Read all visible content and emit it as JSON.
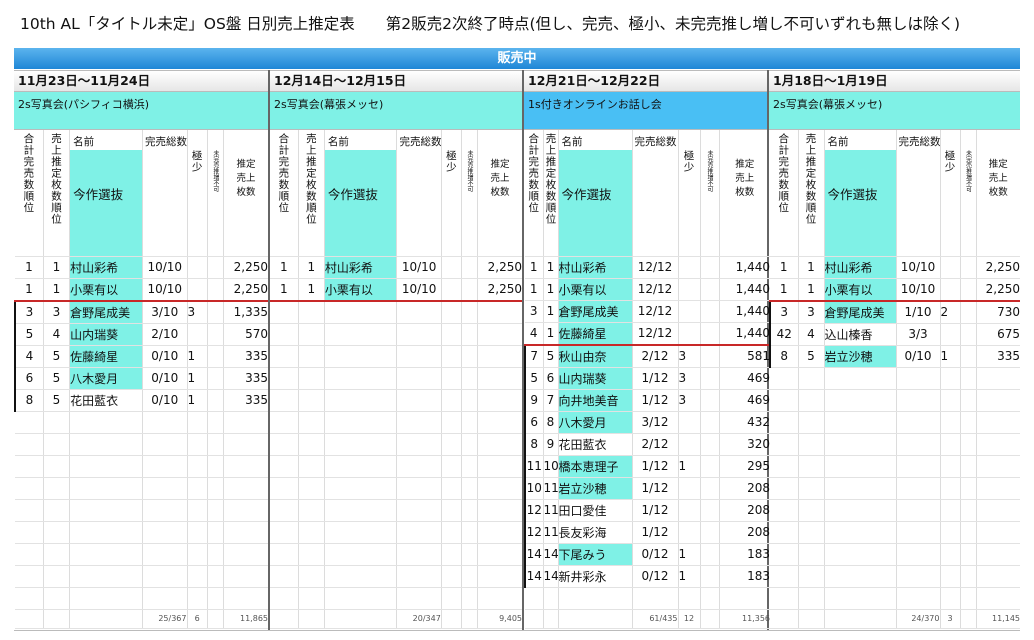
{
  "title": "10th AL「タイトル未定」OS盤 日別売上推定表　　第2販売2次終了時点(但し、完売、極小、未完売推し増し不可いずれも無しは除く)",
  "banner": "販売中",
  "headers": {
    "rank_total": "合計完売数順位",
    "rank_sales": "売上推定枚数順位",
    "name": "名前",
    "current_select": "今作選抜",
    "sold_out_total": "完売総数",
    "kyokusho": "極少",
    "unsold_no_add": "未完売推増不可",
    "estimate_line1": "推定",
    "estimate_line2": "売上",
    "estimate_line3": "枚数"
  },
  "colors": {
    "cyan": "#7ff1e6",
    "blue_event": "#49bff4",
    "banner": "#2a8fdc",
    "cutoff_line": "#c82828"
  },
  "panels": [
    {
      "date": "11月23日〜11月24日",
      "event": "2s写真会(パシフィコ横浜)",
      "rows": [
        {
          "r1": "1",
          "r2": "1",
          "name": "村山彩希",
          "sold": "10/10",
          "ky": "",
          "est": "2,250",
          "cyan": true
        },
        {
          "r1": "1",
          "r2": "1",
          "name": "小栗有以",
          "sold": "10/10",
          "ky": "",
          "est": "2,250",
          "cyan": true,
          "cut": true
        },
        {
          "r1": "3",
          "r2": "3",
          "name": "倉野尾成美",
          "sold": "3/10",
          "ky": "3",
          "est": "1,335",
          "cyan": true
        },
        {
          "r1": "5",
          "r2": "4",
          "name": "山内瑞葵",
          "sold": "2/10",
          "ky": "",
          "est": "570",
          "cyan": true
        },
        {
          "r1": "4",
          "r2": "5",
          "name": "佐藤綺星",
          "sold": "0/10",
          "ky": "1",
          "est": "335",
          "cyan": true
        },
        {
          "r1": "6",
          "r2": "5",
          "name": "八木愛月",
          "sold": "0/10",
          "ky": "1",
          "est": "335",
          "cyan": true
        },
        {
          "r1": "8",
          "r2": "5",
          "name": "花田藍衣",
          "sold": "0/10",
          "ky": "1",
          "est": "335",
          "cyan": false
        }
      ],
      "total": {
        "sold": "25/367",
        "ky": "6",
        "est": "11,865"
      }
    },
    {
      "date": "12月14日〜12月15日",
      "event": "2s写真会(幕張メッセ)",
      "rows": [
        {
          "r1": "1",
          "r2": "1",
          "name": "村山彩希",
          "sold": "10/10",
          "ky": "",
          "est": "2,250",
          "cyan": true
        },
        {
          "r1": "1",
          "r2": "1",
          "name": "小栗有以",
          "sold": "10/10",
          "ky": "",
          "est": "2,250",
          "cyan": true,
          "cut": true
        }
      ],
      "total": {
        "sold": "20/347",
        "ky": "",
        "est": "9,405"
      }
    },
    {
      "date": "12月21日〜12月22日",
      "event": "1s付きオンラインお話し会",
      "rows": [
        {
          "r1": "1",
          "r2": "1",
          "name": "村山彩希",
          "sold": "12/12",
          "ky": "",
          "est": "1,440",
          "cyan": true
        },
        {
          "r1": "1",
          "r2": "1",
          "name": "小栗有以",
          "sold": "12/12",
          "ky": "",
          "est": "1,440",
          "cyan": true
        },
        {
          "r1": "3",
          "r2": "1",
          "name": "倉野尾成美",
          "sold": "12/12",
          "ky": "",
          "est": "1,440",
          "cyan": true
        },
        {
          "r1": "4",
          "r2": "1",
          "name": "佐藤綺星",
          "sold": "12/12",
          "ky": "",
          "est": "1,440",
          "cyan": true,
          "cut": true
        },
        {
          "r1": "7",
          "r2": "5",
          "name": "秋山由奈",
          "sold": "2/12",
          "ky": "3",
          "est": "581",
          "cyan": true
        },
        {
          "r1": "5",
          "r2": "6",
          "name": "山内瑞葵",
          "sold": "1/12",
          "ky": "3",
          "est": "469",
          "cyan": true
        },
        {
          "r1": "9",
          "r2": "7",
          "name": "向井地美音",
          "sold": "1/12",
          "ky": "3",
          "est": "469",
          "cyan": true
        },
        {
          "r1": "6",
          "r2": "8",
          "name": "八木愛月",
          "sold": "3/12",
          "ky": "",
          "est": "432",
          "cyan": true
        },
        {
          "r1": "8",
          "r2": "9",
          "name": "花田藍衣",
          "sold": "2/12",
          "ky": "",
          "est": "320",
          "cyan": false
        },
        {
          "r1": "11",
          "r2": "10",
          "name": "橋本恵理子",
          "sold": "1/12",
          "ky": "1",
          "est": "295",
          "cyan": true
        },
        {
          "r1": "10",
          "r2": "11",
          "name": "岩立沙穂",
          "sold": "1/12",
          "ky": "",
          "est": "208",
          "cyan": true
        },
        {
          "r1": "12",
          "r2": "11",
          "name": "田口愛佳",
          "sold": "1/12",
          "ky": "",
          "est": "208",
          "cyan": false
        },
        {
          "r1": "12",
          "r2": "11",
          "name": "長友彩海",
          "sold": "1/12",
          "ky": "",
          "est": "208",
          "cyan": false
        },
        {
          "r1": "14",
          "r2": "14",
          "name": "下尾みう",
          "sold": "0/12",
          "ky": "1",
          "est": "183",
          "cyan": true
        },
        {
          "r1": "14",
          "r2": "14",
          "name": "新井彩永",
          "sold": "0/12",
          "ky": "1",
          "est": "183",
          "cyan": false
        }
      ],
      "total": {
        "sold": "61/435",
        "ky": "12",
        "est": "11,356"
      }
    },
    {
      "date": "1月18日〜1月19日",
      "event": "2s写真会(幕張メッセ)",
      "rows": [
        {
          "r1": "1",
          "r2": "1",
          "name": "村山彩希",
          "sold": "10/10",
          "ky": "",
          "est": "2,250",
          "cyan": true
        },
        {
          "r1": "1",
          "r2": "1",
          "name": "小栗有以",
          "sold": "10/10",
          "ky": "",
          "est": "2,250",
          "cyan": true,
          "cut": true
        },
        {
          "r1": "3",
          "r2": "3",
          "name": "倉野尾成美",
          "sold": "1/10",
          "ky": "2",
          "est": "730",
          "cyan": true
        },
        {
          "r1": "42",
          "r2": "4",
          "name": "込山榛香",
          "sold": "3/3",
          "ky": "",
          "est": "675",
          "cyan": false
        },
        {
          "r1": "8",
          "r2": "5",
          "name": "岩立沙穂",
          "sold": "0/10",
          "ky": "1",
          "est": "335",
          "cyan": true
        }
      ],
      "total": {
        "sold": "24/370",
        "ky": "3",
        "est": "11,145"
      }
    }
  ]
}
